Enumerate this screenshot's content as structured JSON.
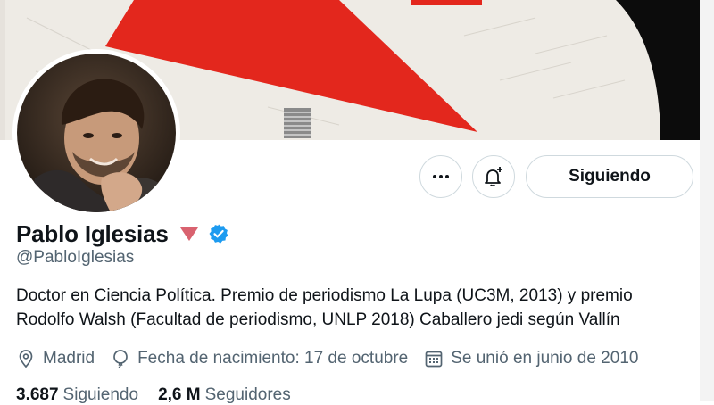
{
  "profile": {
    "display_name": "Pablo Iglesias",
    "handle": "@PabloIglesias",
    "bio": "Doctor en Ciencia Política. Premio de periodismo La Lupa (UC3M, 2013) y premio Rodolfo Walsh (Facultad de periodismo, UNLP 2018) Caballero jedi según Vallín",
    "badge_color": "#d9626f",
    "verified_color": "#1d9bf0"
  },
  "actions": {
    "more_icon": "more-horizontal-icon",
    "notify_icon": "bell-plus-icon",
    "follow_label": "Siguiendo"
  },
  "meta": {
    "location": "Madrid",
    "birthday": "Fecha de nacimiento: 17 de octubre",
    "joined": "Se unió en junio de 2010"
  },
  "stats": {
    "following_count": "3.687",
    "following_label": "Siguiendo",
    "followers_count": "2,6 M",
    "followers_label": "Seguidores"
  }
}
